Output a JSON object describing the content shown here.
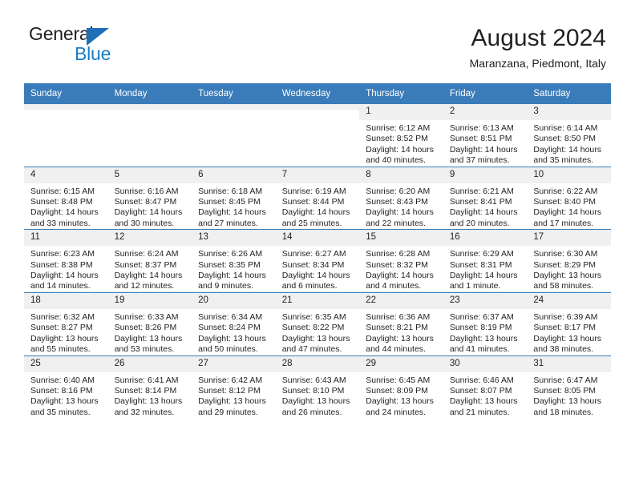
{
  "brand": {
    "name_top": "General",
    "name_bottom": "Blue",
    "accent_color": "#1a7dc4",
    "triangle_color": "#1d70b8"
  },
  "header": {
    "title": "August 2024",
    "subtitle": "Maranzana, Piedmont, Italy"
  },
  "theme": {
    "header_row_bg": "#3a7cb9",
    "daynum_bg": "#f0f0f0",
    "text_color": "#231f20"
  },
  "weekdays": [
    "Sunday",
    "Monday",
    "Tuesday",
    "Wednesday",
    "Thursday",
    "Friday",
    "Saturday"
  ],
  "labels": {
    "sunrise_prefix": "Sunrise:",
    "sunset_prefix": "Sunset:",
    "daylight_prefix": "Daylight:"
  },
  "weeks": [
    [
      {
        "day": "",
        "blank": true,
        "sunrise": "",
        "sunset": "",
        "daylight": ""
      },
      {
        "day": "",
        "blank": true,
        "sunrise": "",
        "sunset": "",
        "daylight": ""
      },
      {
        "day": "",
        "blank": true,
        "sunrise": "",
        "sunset": "",
        "daylight": ""
      },
      {
        "day": "",
        "blank": true,
        "sunrise": "",
        "sunset": "",
        "daylight": ""
      },
      {
        "day": "1",
        "blank": false,
        "sunrise": "Sunrise: 6:12 AM",
        "sunset": "Sunset: 8:52 PM",
        "daylight": "Daylight: 14 hours and 40 minutes."
      },
      {
        "day": "2",
        "blank": false,
        "sunrise": "Sunrise: 6:13 AM",
        "sunset": "Sunset: 8:51 PM",
        "daylight": "Daylight: 14 hours and 37 minutes."
      },
      {
        "day": "3",
        "blank": false,
        "sunrise": "Sunrise: 6:14 AM",
        "sunset": "Sunset: 8:50 PM",
        "daylight": "Daylight: 14 hours and 35 minutes."
      }
    ],
    [
      {
        "day": "4",
        "blank": false,
        "sunrise": "Sunrise: 6:15 AM",
        "sunset": "Sunset: 8:48 PM",
        "daylight": "Daylight: 14 hours and 33 minutes."
      },
      {
        "day": "5",
        "blank": false,
        "sunrise": "Sunrise: 6:16 AM",
        "sunset": "Sunset: 8:47 PM",
        "daylight": "Daylight: 14 hours and 30 minutes."
      },
      {
        "day": "6",
        "blank": false,
        "sunrise": "Sunrise: 6:18 AM",
        "sunset": "Sunset: 8:45 PM",
        "daylight": "Daylight: 14 hours and 27 minutes."
      },
      {
        "day": "7",
        "blank": false,
        "sunrise": "Sunrise: 6:19 AM",
        "sunset": "Sunset: 8:44 PM",
        "daylight": "Daylight: 14 hours and 25 minutes."
      },
      {
        "day": "8",
        "blank": false,
        "sunrise": "Sunrise: 6:20 AM",
        "sunset": "Sunset: 8:43 PM",
        "daylight": "Daylight: 14 hours and 22 minutes."
      },
      {
        "day": "9",
        "blank": false,
        "sunrise": "Sunrise: 6:21 AM",
        "sunset": "Sunset: 8:41 PM",
        "daylight": "Daylight: 14 hours and 20 minutes."
      },
      {
        "day": "10",
        "blank": false,
        "sunrise": "Sunrise: 6:22 AM",
        "sunset": "Sunset: 8:40 PM",
        "daylight": "Daylight: 14 hours and 17 minutes."
      }
    ],
    [
      {
        "day": "11",
        "blank": false,
        "sunrise": "Sunrise: 6:23 AM",
        "sunset": "Sunset: 8:38 PM",
        "daylight": "Daylight: 14 hours and 14 minutes."
      },
      {
        "day": "12",
        "blank": false,
        "sunrise": "Sunrise: 6:24 AM",
        "sunset": "Sunset: 8:37 PM",
        "daylight": "Daylight: 14 hours and 12 minutes."
      },
      {
        "day": "13",
        "blank": false,
        "sunrise": "Sunrise: 6:26 AM",
        "sunset": "Sunset: 8:35 PM",
        "daylight": "Daylight: 14 hours and 9 minutes."
      },
      {
        "day": "14",
        "blank": false,
        "sunrise": "Sunrise: 6:27 AM",
        "sunset": "Sunset: 8:34 PM",
        "daylight": "Daylight: 14 hours and 6 minutes."
      },
      {
        "day": "15",
        "blank": false,
        "sunrise": "Sunrise: 6:28 AM",
        "sunset": "Sunset: 8:32 PM",
        "daylight": "Daylight: 14 hours and 4 minutes."
      },
      {
        "day": "16",
        "blank": false,
        "sunrise": "Sunrise: 6:29 AM",
        "sunset": "Sunset: 8:31 PM",
        "daylight": "Daylight: 14 hours and 1 minute."
      },
      {
        "day": "17",
        "blank": false,
        "sunrise": "Sunrise: 6:30 AM",
        "sunset": "Sunset: 8:29 PM",
        "daylight": "Daylight: 13 hours and 58 minutes."
      }
    ],
    [
      {
        "day": "18",
        "blank": false,
        "sunrise": "Sunrise: 6:32 AM",
        "sunset": "Sunset: 8:27 PM",
        "daylight": "Daylight: 13 hours and 55 minutes."
      },
      {
        "day": "19",
        "blank": false,
        "sunrise": "Sunrise: 6:33 AM",
        "sunset": "Sunset: 8:26 PM",
        "daylight": "Daylight: 13 hours and 53 minutes."
      },
      {
        "day": "20",
        "blank": false,
        "sunrise": "Sunrise: 6:34 AM",
        "sunset": "Sunset: 8:24 PM",
        "daylight": "Daylight: 13 hours and 50 minutes."
      },
      {
        "day": "21",
        "blank": false,
        "sunrise": "Sunrise: 6:35 AM",
        "sunset": "Sunset: 8:22 PM",
        "daylight": "Daylight: 13 hours and 47 minutes."
      },
      {
        "day": "22",
        "blank": false,
        "sunrise": "Sunrise: 6:36 AM",
        "sunset": "Sunset: 8:21 PM",
        "daylight": "Daylight: 13 hours and 44 minutes."
      },
      {
        "day": "23",
        "blank": false,
        "sunrise": "Sunrise: 6:37 AM",
        "sunset": "Sunset: 8:19 PM",
        "daylight": "Daylight: 13 hours and 41 minutes."
      },
      {
        "day": "24",
        "blank": false,
        "sunrise": "Sunrise: 6:39 AM",
        "sunset": "Sunset: 8:17 PM",
        "daylight": "Daylight: 13 hours and 38 minutes."
      }
    ],
    [
      {
        "day": "25",
        "blank": false,
        "sunrise": "Sunrise: 6:40 AM",
        "sunset": "Sunset: 8:16 PM",
        "daylight": "Daylight: 13 hours and 35 minutes."
      },
      {
        "day": "26",
        "blank": false,
        "sunrise": "Sunrise: 6:41 AM",
        "sunset": "Sunset: 8:14 PM",
        "daylight": "Daylight: 13 hours and 32 minutes."
      },
      {
        "day": "27",
        "blank": false,
        "sunrise": "Sunrise: 6:42 AM",
        "sunset": "Sunset: 8:12 PM",
        "daylight": "Daylight: 13 hours and 29 minutes."
      },
      {
        "day": "28",
        "blank": false,
        "sunrise": "Sunrise: 6:43 AM",
        "sunset": "Sunset: 8:10 PM",
        "daylight": "Daylight: 13 hours and 26 minutes."
      },
      {
        "day": "29",
        "blank": false,
        "sunrise": "Sunrise: 6:45 AM",
        "sunset": "Sunset: 8:09 PM",
        "daylight": "Daylight: 13 hours and 24 minutes."
      },
      {
        "day": "30",
        "blank": false,
        "sunrise": "Sunrise: 6:46 AM",
        "sunset": "Sunset: 8:07 PM",
        "daylight": "Daylight: 13 hours and 21 minutes."
      },
      {
        "day": "31",
        "blank": false,
        "sunrise": "Sunrise: 6:47 AM",
        "sunset": "Sunset: 8:05 PM",
        "daylight": "Daylight: 13 hours and 18 minutes."
      }
    ]
  ]
}
